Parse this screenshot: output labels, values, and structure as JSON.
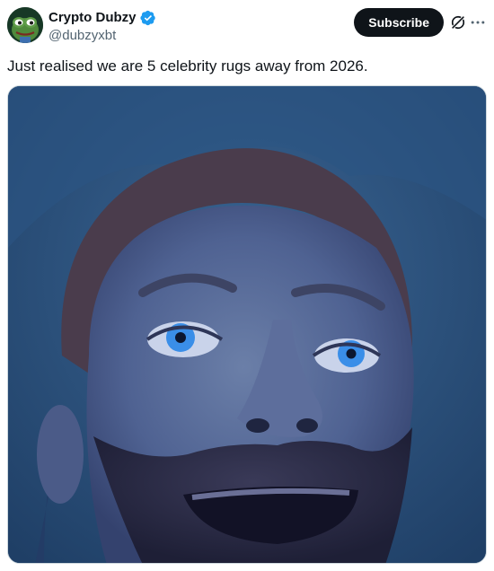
{
  "author": {
    "display_name": "Crypto Dubzy",
    "handle": "@dubzyxbt",
    "verified": true,
    "avatar_icon": "pepe-frog-avatar",
    "verified_color": "#1d9bf0"
  },
  "actions": {
    "subscribe_label": "Subscribe",
    "grok_icon": "grok-icon",
    "more_icon": "more-options-icon"
  },
  "tweet": {
    "text": "Just realised we are 5 celebrity rugs away from 2026."
  },
  "media": {
    "type": "photo",
    "subject": "face-looking-up-image"
  },
  "colors": {
    "text": "#0f1419",
    "secondary": "#536471",
    "button_bg": "#0f1419",
    "button_text": "#ffffff"
  }
}
